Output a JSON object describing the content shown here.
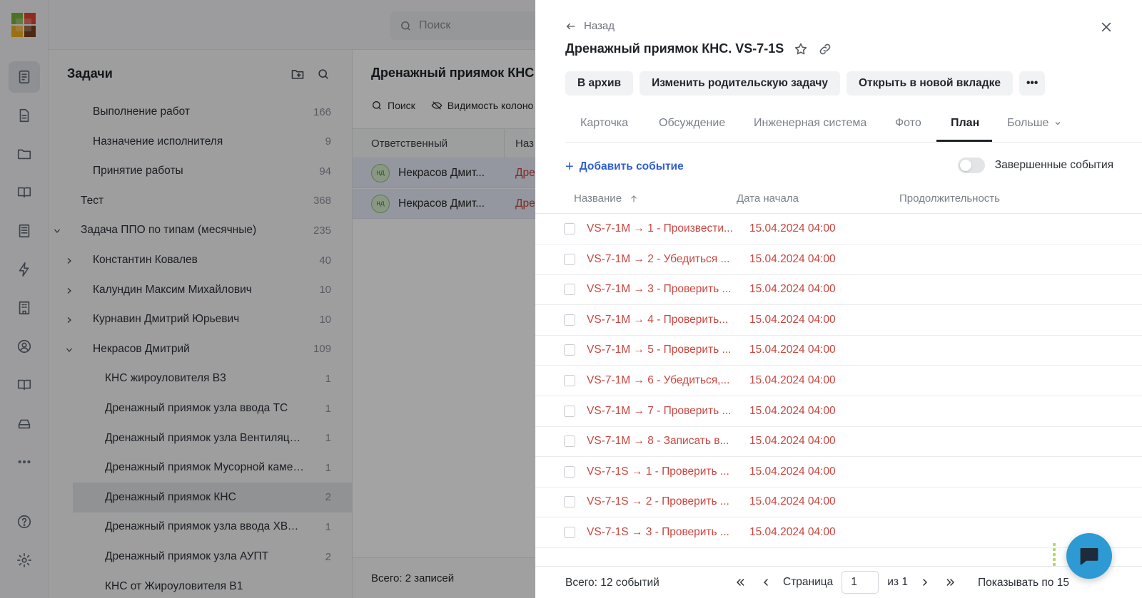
{
  "search": {
    "placeholder": "Поиск"
  },
  "tasks": {
    "title": "Задачи",
    "rows": [
      {
        "label": "Выполнение работ",
        "count": "166",
        "level": 1,
        "chevron": "none"
      },
      {
        "label": "Назначение исполнителя",
        "count": "9",
        "level": 1,
        "chevron": "none"
      },
      {
        "label": "Принятие работы",
        "count": "94",
        "level": 1,
        "chevron": "none"
      },
      {
        "label": "Тест",
        "count": "368",
        "level": 0,
        "chevron": "none"
      },
      {
        "label": "Задача ППО по типам (месячные)",
        "count": "235",
        "level": 0,
        "chevron": "down"
      },
      {
        "label": "Константин Ковалев",
        "count": "40",
        "level": 1,
        "chevron": "right"
      },
      {
        "label": "Калундин Максим Михайлович",
        "count": "10",
        "level": 1,
        "chevron": "right"
      },
      {
        "label": "Курнавин Дмитрий Юрьевич",
        "count": "10",
        "level": 1,
        "chevron": "right"
      },
      {
        "label": "Некрасов Дмитрий",
        "count": "109",
        "level": 1,
        "chevron": "down"
      },
      {
        "label": "КНС жироуловителя В3",
        "count": "1",
        "level": 2,
        "chevron": "none"
      },
      {
        "label": "Дренажный приямок узла ввода ТС",
        "count": "1",
        "level": 2,
        "chevron": "none"
      },
      {
        "label": "Дренажный приямок узла Вентиляционно...",
        "count": "1",
        "level": 2,
        "chevron": "none"
      },
      {
        "label": "Дренажный приямок Мусорной камеры",
        "count": "1",
        "level": 2,
        "chevron": "none"
      },
      {
        "label": "Дренажный приямок КНС",
        "count": "2",
        "level": 2,
        "chevron": "none",
        "selected": true
      },
      {
        "label": "Дренажный приямок узла ввода ХВС и ГВС",
        "count": "1",
        "level": 2,
        "chevron": "none"
      },
      {
        "label": "Дренажный приямок узла АУПТ",
        "count": "2",
        "level": 2,
        "chevron": "none"
      },
      {
        "label": "КНС от Жироуловителя В1",
        "count": "",
        "level": 2,
        "chevron": "none"
      }
    ]
  },
  "middle": {
    "title": "Дренажный приямок КНС",
    "tool_search": "Поиск",
    "tool_visibility": "Видимость колоно",
    "col_responsible": "Ответственный",
    "col_name": "Наз",
    "rows": [
      {
        "initials": "нд",
        "responsible": "Некрасов Дмит...",
        "name": "Дре"
      },
      {
        "initials": "нд",
        "responsible": "Некрасов Дмит...",
        "name": "Дре"
      }
    ],
    "total": "Всего: 2 записей"
  },
  "drawer": {
    "back_label": "Назад",
    "title": "Дренажный приямок КНС. VS-7-1S",
    "actions": {
      "archive": "В архив",
      "change_parent": "Изменить родительскую задачу",
      "open_new_tab": "Открыть в новой вкладке",
      "more": "•••"
    },
    "tabs": [
      "Карточка",
      "Обсуждение",
      "Инженерная система",
      "Фото",
      "План",
      "Больше"
    ],
    "active_tab": "План",
    "add_event": "Добавить событие",
    "completed_events": "Завершенные события",
    "columns": {
      "name": "Название",
      "start": "Дата начала",
      "duration": "Продолжительность"
    },
    "events": [
      {
        "name": "VS-7-1M → 1 - Произвести...",
        "start": "15.04.2024 04:00"
      },
      {
        "name": "VS-7-1M → 2 - Убедиться ...",
        "start": "15.04.2024 04:00"
      },
      {
        "name": "VS-7-1M → 3 - Проверить ...",
        "start": "15.04.2024 04:00"
      },
      {
        "name": "VS-7-1M → 4 - Проверить...",
        "start": "15.04.2024 04:00"
      },
      {
        "name": "VS-7-1M → 5 - Проверить ...",
        "start": "15.04.2024 04:00"
      },
      {
        "name": "VS-7-1M → 6 - Убедиться,...",
        "start": "15.04.2024 04:00"
      },
      {
        "name": "VS-7-1M → 7 - Проверить ...",
        "start": "15.04.2024 04:00"
      },
      {
        "name": "VS-7-1M → 8 - Записать в...",
        "start": "15.04.2024 04:00"
      },
      {
        "name": "VS-7-1S → 1 - Проверить ...",
        "start": "15.04.2024 04:00"
      },
      {
        "name": "VS-7-1S → 2 - Проверить ...",
        "start": "15.04.2024 04:00"
      },
      {
        "name": "VS-7-1S → 3 - Проверить ...",
        "start": "15.04.2024 04:00"
      }
    ],
    "footer": {
      "total": "Всего: 12 событий",
      "page_label": "Страница",
      "page_value": "1",
      "of_label": "из 1",
      "per_page": "Показывать по 15"
    }
  },
  "colors": {
    "accent": "#2f5fd0",
    "link_red": "#c9463f",
    "chat": "#2d9ad4"
  }
}
